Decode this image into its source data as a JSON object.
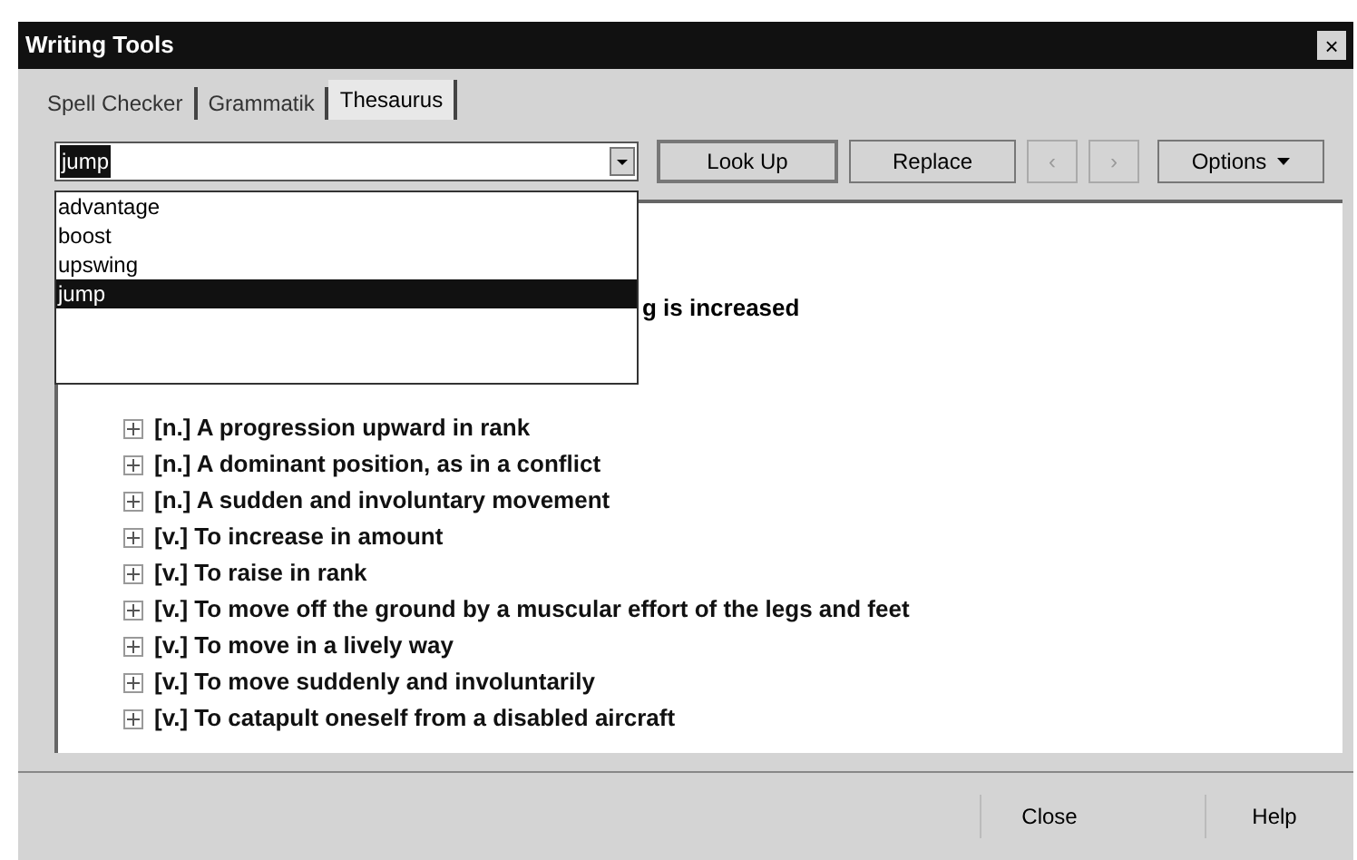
{
  "window": {
    "title": "Writing Tools",
    "close": "×"
  },
  "tabs": [
    {
      "label": "Spell Checker",
      "selected": false
    },
    {
      "label": "Grammatik",
      "selected": false
    },
    {
      "label": "Thesaurus",
      "selected": true
    }
  ],
  "lookup_field": {
    "value": "jump",
    "expanded": true,
    "options": [
      {
        "label": "advantage",
        "selected": false
      },
      {
        "label": "boost",
        "selected": false
      },
      {
        "label": "upswing",
        "selected": false
      },
      {
        "label": "jump",
        "selected": true
      }
    ]
  },
  "toolbar": [
    {
      "kind": "button",
      "label": "Look Up",
      "disabled": false
    },
    {
      "kind": "button",
      "label": "Replace",
      "disabled": false
    },
    {
      "kind": "nav",
      "label": "‹",
      "disabled": true
    },
    {
      "kind": "nav",
      "label": "›",
      "disabled": true
    },
    {
      "kind": "menu",
      "label": "Options",
      "disabled": false
    }
  ],
  "tree": {
    "partial_item": "g is increased",
    "items": [
      {
        "text": "[n.] A progression upward in rank",
        "expanded": false
      },
      {
        "text": "[n.] A dominant position, as in a conflict",
        "expanded": false
      },
      {
        "text": "[n.] A sudden and involuntary movement",
        "expanded": false
      },
      {
        "text": "[v.] To increase in amount",
        "expanded": false
      },
      {
        "text": "[v.] To raise in rank",
        "expanded": false
      },
      {
        "text": "[v.] To move off the ground by a muscular effort of the legs and feet",
        "expanded": false
      },
      {
        "text": "[v.] To move in a lively way",
        "expanded": false
      },
      {
        "text": "[v.] To move suddenly and involuntarily",
        "expanded": false
      },
      {
        "text": "[v.] To catapult oneself from a disabled aircraft",
        "expanded": false
      }
    ]
  },
  "buttons": [
    "Close",
    "Help"
  ]
}
